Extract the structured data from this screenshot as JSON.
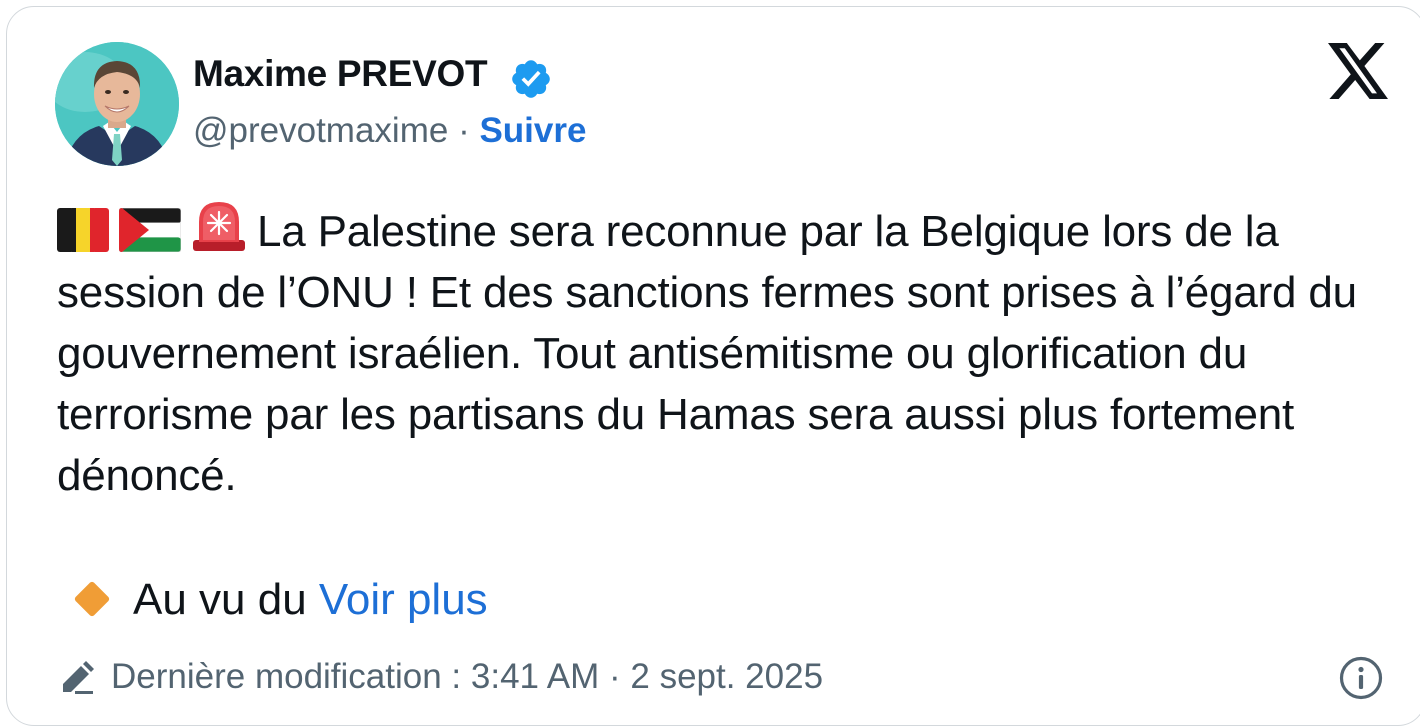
{
  "author": {
    "display_name": "Maxime PREVOT",
    "handle": "@prevotmaxime",
    "separator": "·",
    "follow_label": "Suivre",
    "verified": true,
    "avatar": "avatar-photo"
  },
  "platform": {
    "logo_icon": "x-logo-icon"
  },
  "tweet": {
    "leading_emojis": [
      "belgium-flag-icon",
      "palestine-flag-icon",
      "rotating-light-icon"
    ],
    "text": "La Palestine sera reconnue par la Belgique lors de la session de l’ONU ! Et des sanctions fermes sont prises à l’égard du gouvernement israélien. Tout antisémitisme ou glorification du terrorisme par les partisans du Hamas sera aussi plus fortement dénoncé.",
    "continuation_prefix": "Au vu du",
    "see_more_label": "Voir plus",
    "bullet_icon": "orange-diamond-icon"
  },
  "footer": {
    "edit_icon": "pencil-icon",
    "edited_label": "Dernière modification : 3:41 AM · 2 sept. 2025",
    "info_icon": "info-icon"
  },
  "colors": {
    "text": "#0f1419",
    "secondary": "#536471",
    "link": "#1d6fd6",
    "verified": "#1d9bf0",
    "accent_diamond": "#f09d36",
    "border": "#d3d8dc"
  }
}
